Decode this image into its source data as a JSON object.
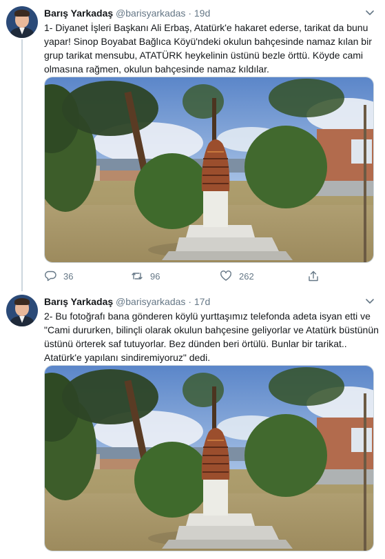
{
  "tweets": [
    {
      "name": "Barış Yarkadaş",
      "handle": "@barisyarkadas",
      "separator": "·",
      "age": "19d",
      "text": "1- Diyanet İşleri Başkanı Ali Erbaş, Atatürk'e hakaret ederse, tarikat da bunu yapar! Sinop Boyabat Bağlıca Köyü'ndeki okulun bahçesinde  namaz kılan bir grup tarikat mensubu, ATATÜRK heykelinin üstünü bezle örttü. Köyde cami olmasına rağmen, okulun bahçesinde namaz kıldılar.",
      "replies": "36",
      "retweets": "96",
      "likes": "262"
    },
    {
      "name": "Barış Yarkadaş",
      "handle": "@barisyarkadas",
      "separator": "·",
      "age": "17d",
      "text": "2- Bu fotoğrafı bana gönderen köylü yurttaşımız telefonda adeta isyan etti ve \"Cami dururken, bilinçli olarak okulun bahçesine geliyorlar ve Atatürk büstünün üstünü örterek saf tutuyorlar. Bez dünden beri örtülü. Bunlar bir tarikat.. Atatürk'e yapılanı sindiremiyoruz\" dedi."
    }
  ],
  "icons": {
    "reply": "reply-icon",
    "retweet": "retweet-icon",
    "like": "heart-icon",
    "share": "share-icon",
    "more": "chevron-down-icon"
  },
  "colors": {
    "text": "#14171a",
    "secondary": "#657786",
    "border": "#ccd6dd"
  }
}
